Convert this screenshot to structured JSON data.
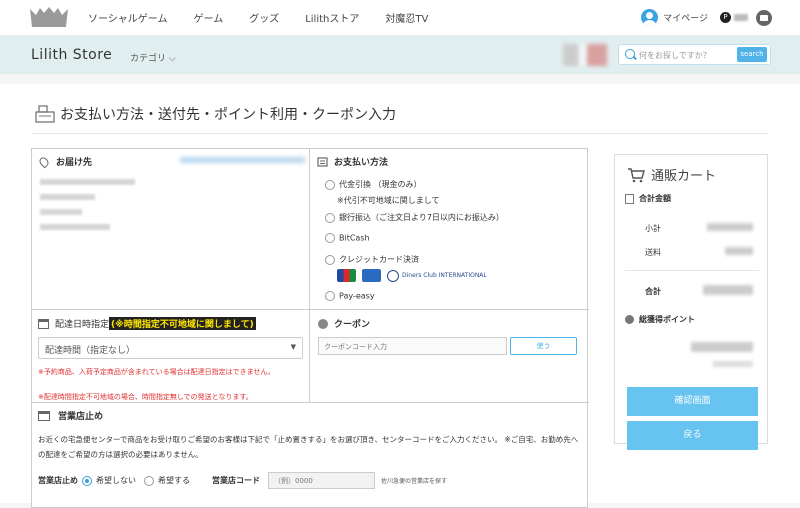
{
  "topnav": {
    "logo_text": "LILITH",
    "links": [
      "ソーシャルゲーム",
      "ゲーム",
      "グッズ",
      "Lilithストア",
      "対魔忍TV"
    ],
    "mypage": "マイページ",
    "points_badge": "P"
  },
  "storebar": {
    "title": "Lilith Store",
    "category": "カテゴリ",
    "search_placeholder": "何をお探しですか？",
    "search_button": "search"
  },
  "page": {
    "title": "お支払い方法・送付先・ポイント利用・クーポン入力"
  },
  "delivery": {
    "heading": "お届け先"
  },
  "payment": {
    "heading": "お支払い方法",
    "options": [
      {
        "label": "代金引換 （現金のみ）",
        "note": "※代引不可地域に関しまして"
      },
      {
        "label": "銀行振込（ご注文日より7日以内にお振込み）",
        "note": ""
      },
      {
        "label": "BitCash",
        "note": ""
      },
      {
        "label": "クレジットカード決済",
        "note": ""
      },
      {
        "label": "Pay-easy",
        "note": ""
      }
    ],
    "card_logo_text": "Diners Club INTERNATIONAL"
  },
  "delivery_time": {
    "heading": "配達日時指定",
    "highlight": "(※時間指定不可地域に関しまして)",
    "select_value": "配達時間（指定なし）",
    "note1": "※予約商品、入荷予定商品が含まれている場合は配達日指定はできません。",
    "note2": "※配達時間指定不可地域の場合、時間指定無しでの発送となります。"
  },
  "coupon": {
    "heading": "クーポン",
    "placeholder": "クーポンコード入力",
    "button": "使う"
  },
  "office_stop": {
    "heading": "営業店止め",
    "description": "お近くの宅急便センターで商品をお受け取りご希望のお客様は下記で「止め置きする」をお選び頂き、センターコードをご入力ください。 ※ご自宅、お勤め先への配達をご希望の方は選択の必要はありません。",
    "label": "営業店止め",
    "opt_no": "希望しない",
    "opt_yes": "希望する",
    "code_label": "営業店コード",
    "code_placeholder": "（例）0000",
    "find_link": "佐川急便の営業店を探す"
  },
  "cart": {
    "title": "通販カート",
    "total_heading": "合計金額",
    "subtotal": "小計",
    "shipping": "送料",
    "total": "合計",
    "points_heading": "総獲得ポイント",
    "confirm_button": "確認画面",
    "back_button": "戻る"
  }
}
